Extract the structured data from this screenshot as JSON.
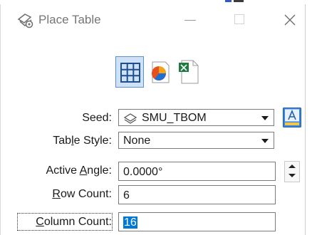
{
  "window": {
    "title": "Place Table",
    "buttons": {
      "minimize": "minimize-icon",
      "maximize": "maximize-icon",
      "close": "close-icon"
    }
  },
  "toolbar": {
    "items": [
      {
        "icon": "table-grid-icon",
        "selected": true
      },
      {
        "icon": "pie-chart-icon",
        "selected": false
      },
      {
        "icon": "excel-file-icon",
        "selected": false
      }
    ]
  },
  "form": {
    "seed": {
      "label": "Seed:",
      "value": "SMU_TBOM",
      "icon": "seed-cell-icon"
    },
    "table_style": {
      "label": "Table Style:",
      "value": "None"
    },
    "active_angle": {
      "label": "Active Angle:",
      "value": "0.0000°"
    },
    "row_count": {
      "label": "Row Count:",
      "value": "6"
    },
    "column_count": {
      "label": "Column Count:",
      "value": "16"
    }
  },
  "colors": {
    "accent": "#0078d7",
    "selected_tool_bg": "#cfe1f7",
    "selected_tool_border": "#5b8fd6",
    "text_style_icon": "#1e6fd1"
  }
}
